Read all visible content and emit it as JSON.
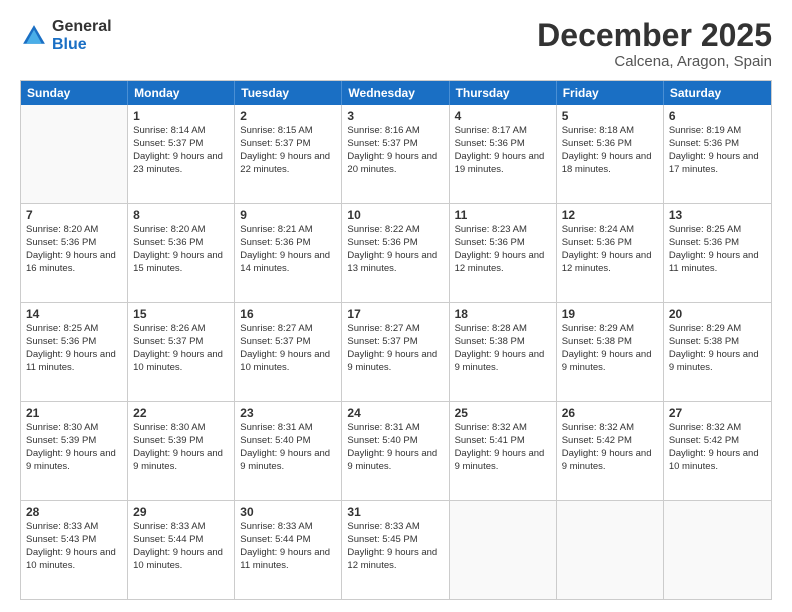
{
  "logo": {
    "general": "General",
    "blue": "Blue"
  },
  "header": {
    "month": "December 2025",
    "location": "Calcena, Aragon, Spain"
  },
  "days": [
    "Sunday",
    "Monday",
    "Tuesday",
    "Wednesday",
    "Thursday",
    "Friday",
    "Saturday"
  ],
  "weeks": [
    [
      {
        "day": "",
        "sunrise": "",
        "sunset": "",
        "daylight": ""
      },
      {
        "day": "1",
        "sunrise": "Sunrise: 8:14 AM",
        "sunset": "Sunset: 5:37 PM",
        "daylight": "Daylight: 9 hours and 23 minutes."
      },
      {
        "day": "2",
        "sunrise": "Sunrise: 8:15 AM",
        "sunset": "Sunset: 5:37 PM",
        "daylight": "Daylight: 9 hours and 22 minutes."
      },
      {
        "day": "3",
        "sunrise": "Sunrise: 8:16 AM",
        "sunset": "Sunset: 5:37 PM",
        "daylight": "Daylight: 9 hours and 20 minutes."
      },
      {
        "day": "4",
        "sunrise": "Sunrise: 8:17 AM",
        "sunset": "Sunset: 5:36 PM",
        "daylight": "Daylight: 9 hours and 19 minutes."
      },
      {
        "day": "5",
        "sunrise": "Sunrise: 8:18 AM",
        "sunset": "Sunset: 5:36 PM",
        "daylight": "Daylight: 9 hours and 18 minutes."
      },
      {
        "day": "6",
        "sunrise": "Sunrise: 8:19 AM",
        "sunset": "Sunset: 5:36 PM",
        "daylight": "Daylight: 9 hours and 17 minutes."
      }
    ],
    [
      {
        "day": "7",
        "sunrise": "Sunrise: 8:20 AM",
        "sunset": "Sunset: 5:36 PM",
        "daylight": "Daylight: 9 hours and 16 minutes."
      },
      {
        "day": "8",
        "sunrise": "Sunrise: 8:20 AM",
        "sunset": "Sunset: 5:36 PM",
        "daylight": "Daylight: 9 hours and 15 minutes."
      },
      {
        "day": "9",
        "sunrise": "Sunrise: 8:21 AM",
        "sunset": "Sunset: 5:36 PM",
        "daylight": "Daylight: 9 hours and 14 minutes."
      },
      {
        "day": "10",
        "sunrise": "Sunrise: 8:22 AM",
        "sunset": "Sunset: 5:36 PM",
        "daylight": "Daylight: 9 hours and 13 minutes."
      },
      {
        "day": "11",
        "sunrise": "Sunrise: 8:23 AM",
        "sunset": "Sunset: 5:36 PM",
        "daylight": "Daylight: 9 hours and 12 minutes."
      },
      {
        "day": "12",
        "sunrise": "Sunrise: 8:24 AM",
        "sunset": "Sunset: 5:36 PM",
        "daylight": "Daylight: 9 hours and 12 minutes."
      },
      {
        "day": "13",
        "sunrise": "Sunrise: 8:25 AM",
        "sunset": "Sunset: 5:36 PM",
        "daylight": "Daylight: 9 hours and 11 minutes."
      }
    ],
    [
      {
        "day": "14",
        "sunrise": "Sunrise: 8:25 AM",
        "sunset": "Sunset: 5:36 PM",
        "daylight": "Daylight: 9 hours and 11 minutes."
      },
      {
        "day": "15",
        "sunrise": "Sunrise: 8:26 AM",
        "sunset": "Sunset: 5:37 PM",
        "daylight": "Daylight: 9 hours and 10 minutes."
      },
      {
        "day": "16",
        "sunrise": "Sunrise: 8:27 AM",
        "sunset": "Sunset: 5:37 PM",
        "daylight": "Daylight: 9 hours and 10 minutes."
      },
      {
        "day": "17",
        "sunrise": "Sunrise: 8:27 AM",
        "sunset": "Sunset: 5:37 PM",
        "daylight": "Daylight: 9 hours and 9 minutes."
      },
      {
        "day": "18",
        "sunrise": "Sunrise: 8:28 AM",
        "sunset": "Sunset: 5:38 PM",
        "daylight": "Daylight: 9 hours and 9 minutes."
      },
      {
        "day": "19",
        "sunrise": "Sunrise: 8:29 AM",
        "sunset": "Sunset: 5:38 PM",
        "daylight": "Daylight: 9 hours and 9 minutes."
      },
      {
        "day": "20",
        "sunrise": "Sunrise: 8:29 AM",
        "sunset": "Sunset: 5:38 PM",
        "daylight": "Daylight: 9 hours and 9 minutes."
      }
    ],
    [
      {
        "day": "21",
        "sunrise": "Sunrise: 8:30 AM",
        "sunset": "Sunset: 5:39 PM",
        "daylight": "Daylight: 9 hours and 9 minutes."
      },
      {
        "day": "22",
        "sunrise": "Sunrise: 8:30 AM",
        "sunset": "Sunset: 5:39 PM",
        "daylight": "Daylight: 9 hours and 9 minutes."
      },
      {
        "day": "23",
        "sunrise": "Sunrise: 8:31 AM",
        "sunset": "Sunset: 5:40 PM",
        "daylight": "Daylight: 9 hours and 9 minutes."
      },
      {
        "day": "24",
        "sunrise": "Sunrise: 8:31 AM",
        "sunset": "Sunset: 5:40 PM",
        "daylight": "Daylight: 9 hours and 9 minutes."
      },
      {
        "day": "25",
        "sunrise": "Sunrise: 8:32 AM",
        "sunset": "Sunset: 5:41 PM",
        "daylight": "Daylight: 9 hours and 9 minutes."
      },
      {
        "day": "26",
        "sunrise": "Sunrise: 8:32 AM",
        "sunset": "Sunset: 5:42 PM",
        "daylight": "Daylight: 9 hours and 9 minutes."
      },
      {
        "day": "27",
        "sunrise": "Sunrise: 8:32 AM",
        "sunset": "Sunset: 5:42 PM",
        "daylight": "Daylight: 9 hours and 10 minutes."
      }
    ],
    [
      {
        "day": "28",
        "sunrise": "Sunrise: 8:33 AM",
        "sunset": "Sunset: 5:43 PM",
        "daylight": "Daylight: 9 hours and 10 minutes."
      },
      {
        "day": "29",
        "sunrise": "Sunrise: 8:33 AM",
        "sunset": "Sunset: 5:44 PM",
        "daylight": "Daylight: 9 hours and 10 minutes."
      },
      {
        "day": "30",
        "sunrise": "Sunrise: 8:33 AM",
        "sunset": "Sunset: 5:44 PM",
        "daylight": "Daylight: 9 hours and 11 minutes."
      },
      {
        "day": "31",
        "sunrise": "Sunrise: 8:33 AM",
        "sunset": "Sunset: 5:45 PM",
        "daylight": "Daylight: 9 hours and 12 minutes."
      },
      {
        "day": "",
        "sunrise": "",
        "sunset": "",
        "daylight": ""
      },
      {
        "day": "",
        "sunrise": "",
        "sunset": "",
        "daylight": ""
      },
      {
        "day": "",
        "sunrise": "",
        "sunset": "",
        "daylight": ""
      }
    ]
  ]
}
